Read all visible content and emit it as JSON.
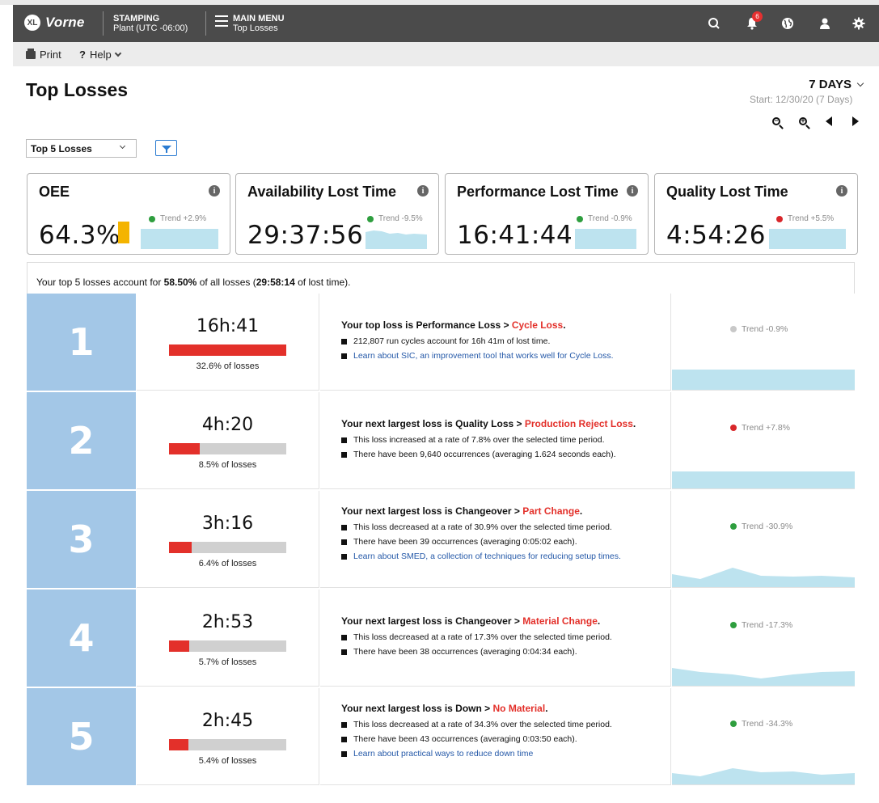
{
  "topbar": {
    "logo_badge": "XL",
    "logo_text": "Vorne",
    "line_label": "STAMPING",
    "plant_label": "Plant (UTC -06:00)",
    "menu_label": "MAIN MENU",
    "menu_sub": "Top Losses",
    "notification_count": "6"
  },
  "toolbar": {
    "print_label": "Print",
    "help_label": "Help"
  },
  "page": {
    "title": "Top Losses",
    "range_label": "7 DAYS",
    "range_start": "Start: 12/30/20 (7 Days)"
  },
  "filter": {
    "selected": "Top 5 Losses"
  },
  "kpis": [
    {
      "title": "OEE",
      "value": "64.3%",
      "trend_label": "Trend +2.9%",
      "trend_color": "#2e9e3e"
    },
    {
      "title": "Availability Lost Time",
      "value": "29:37:56",
      "trend_label": "Trend -9.5%",
      "trend_color": "#2e9e3e"
    },
    {
      "title": "Performance Lost Time",
      "value": "16:41:44",
      "trend_label": "Trend -0.9%",
      "trend_color": "#2e9e3e"
    },
    {
      "title": "Quality Lost Time",
      "value": "4:54:26",
      "trend_label": "Trend +5.5%",
      "trend_color": "#d8262a"
    }
  ],
  "summary": {
    "prefix": "Your top 5 losses account for ",
    "percent": "58.50%",
    "middle": " of all losses (",
    "time": "29:58:14",
    "suffix": " of lost time)."
  },
  "losses": [
    {
      "rank": "1",
      "time": "16h:41",
      "share": 0.326,
      "share_label": "32.6% of losses",
      "headline_prefix": "Your top loss is Performance Loss > ",
      "headline_loss": "Cycle Loss",
      "bullets": [
        {
          "text": "212,807 run cycles account for 16h 41m of lost time.",
          "link": false
        },
        {
          "text": "Learn about SIC, an improvement tool that works well for Cycle Loss.",
          "link": true
        }
      ],
      "trend_label": "Trend -0.9%",
      "trend_color": "#c8c8c8"
    },
    {
      "rank": "2",
      "time": "4h:20",
      "share": 0.085,
      "share_label": "8.5% of losses",
      "headline_prefix": "Your next largest loss is Quality Loss > ",
      "headline_loss": "Production Reject Loss",
      "bullets": [
        {
          "text": "This loss increased at a rate of 7.8% over the selected time period.",
          "link": false
        },
        {
          "text": "There have been 9,640 occurrences (averaging 1.624 seconds each).",
          "link": false
        }
      ],
      "trend_label": "Trend +7.8%",
      "trend_color": "#d8262a"
    },
    {
      "rank": "3",
      "time": "3h:16",
      "share": 0.064,
      "share_label": "6.4% of losses",
      "headline_prefix": "Your next largest loss is Changeover > ",
      "headline_loss": "Part Change",
      "bullets": [
        {
          "text": "This loss decreased at a rate of 30.9% over the selected time period.",
          "link": false
        },
        {
          "text": "There have been 39 occurrences (averaging 0:05:02 each).",
          "link": false
        },
        {
          "text": "Learn about SMED, a collection of techniques for reducing setup times.",
          "link": true
        }
      ],
      "trend_label": "Trend -30.9%",
      "trend_color": "#2e9e3e"
    },
    {
      "rank": "4",
      "time": "2h:53",
      "share": 0.057,
      "share_label": "5.7% of losses",
      "headline_prefix": "Your next largest loss is Changeover > ",
      "headline_loss": "Material Change",
      "bullets": [
        {
          "text": "This loss decreased at a rate of 17.3% over the selected time period.",
          "link": false
        },
        {
          "text": "There have been 38 occurrences (averaging 0:04:34 each).",
          "link": false
        }
      ],
      "trend_label": "Trend -17.3%",
      "trend_color": "#2e9e3e"
    },
    {
      "rank": "5",
      "time": "2h:45",
      "share": 0.054,
      "share_label": "5.4% of losses",
      "headline_prefix": "Your next largest loss is Down > ",
      "headline_loss": "No Material",
      "bullets": [
        {
          "text": "This loss decreased at a rate of 34.3% over the selected time period.",
          "link": false
        },
        {
          "text": "There have been 43 occurrences (averaging 0:03:50 each).",
          "link": false
        },
        {
          "text": "Learn about practical ways to reduce down time",
          "link": true
        }
      ],
      "trend_label": "Trend -34.3%",
      "trend_color": "#2e9e3e"
    }
  ]
}
